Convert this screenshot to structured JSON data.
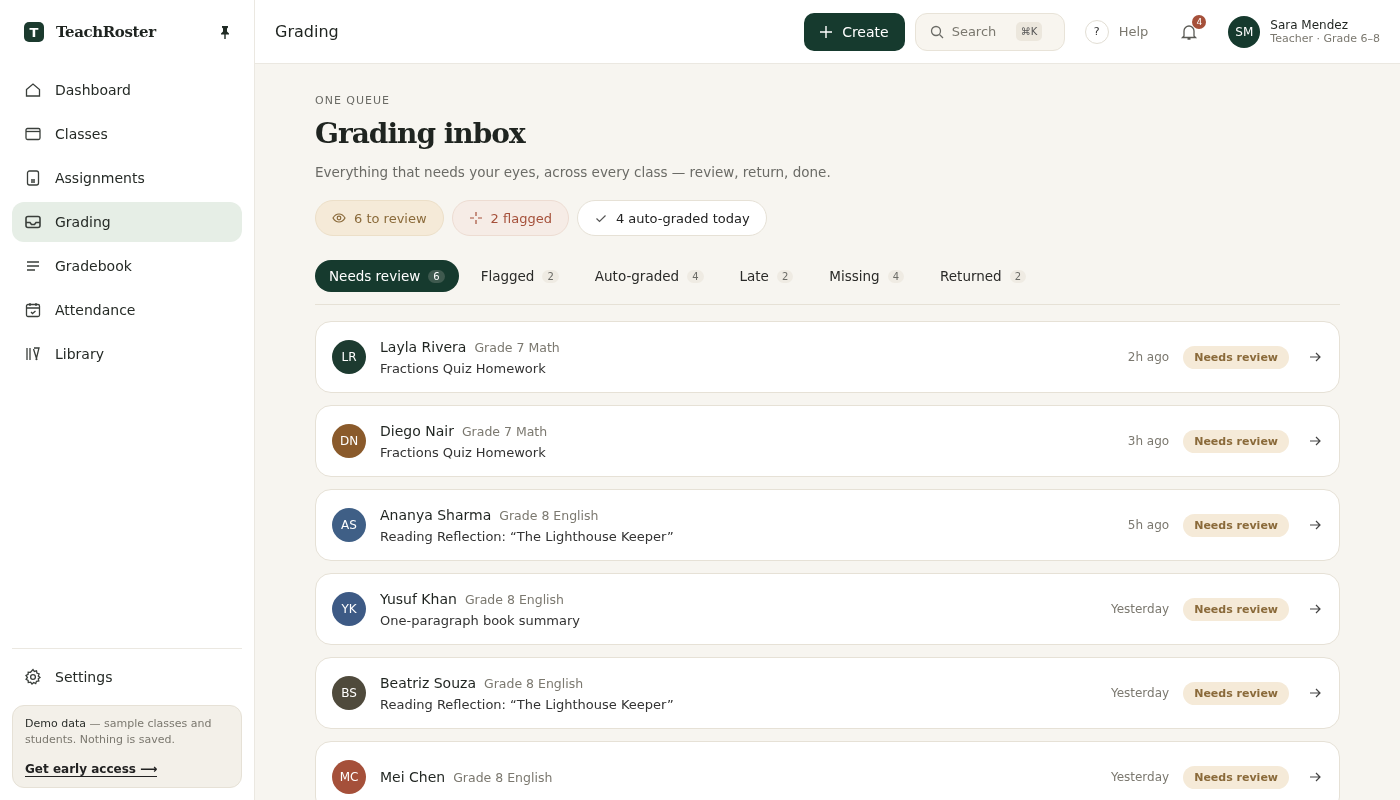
{
  "brand": {
    "name": "TeachRoster",
    "logo_letter": "T"
  },
  "nav": [
    {
      "label": "Dashboard",
      "kind": "home",
      "selected": false
    },
    {
      "label": "Classes",
      "kind": "card",
      "selected": false
    },
    {
      "label": "Assignments",
      "kind": "doc",
      "selected": false
    },
    {
      "label": "Grading",
      "kind": "inbox",
      "selected": true
    },
    {
      "label": "Gradebook",
      "kind": "lines",
      "selected": false
    },
    {
      "label": "Attendance",
      "kind": "calendar",
      "selected": false
    },
    {
      "label": "Library",
      "kind": "books",
      "selected": false
    }
  ],
  "settings": {
    "label": "Settings"
  },
  "demo_note": {
    "text": "**Demo data** — sample classes and students. Nothing is saved.",
    "link": "Get early access ⟶"
  },
  "header": {
    "title": "Grading",
    "create": "Create",
    "search_placeholder": "Search",
    "shortcut": "⌘K",
    "help_mark": "?",
    "help": "Help",
    "notifications": "4",
    "user": {
      "initials": "SM",
      "name": "Sara Mendez",
      "role": "Teacher · Grade 6–8"
    }
  },
  "page": {
    "eyebrow": "ONE QUEUE",
    "title": "Grading inbox",
    "subtitle": "Everything that needs your eyes, across every class — review, return, done."
  },
  "summary_chips": [
    {
      "kind": "review",
      "label": "6 to review"
    },
    {
      "kind": "flagged",
      "label": "2 flagged"
    },
    {
      "kind": "auto",
      "label": "4 auto-graded today"
    }
  ],
  "tabs": [
    {
      "label": "Needs review",
      "count": "6",
      "selected": true
    },
    {
      "label": "Flagged",
      "count": "2",
      "selected": false
    },
    {
      "label": "Auto-graded",
      "count": "4",
      "selected": false
    },
    {
      "label": "Late",
      "count": "2",
      "selected": false
    },
    {
      "label": "Missing",
      "count": "4",
      "selected": false
    },
    {
      "label": "Returned",
      "count": "2",
      "selected": false
    }
  ],
  "submissions": [
    {
      "initials": "LR",
      "color": "#1d3b30",
      "name": "Layla Rivera",
      "class": "Grade 7 Math",
      "assignment": "Fractions Quiz Homework",
      "time": "2h ago",
      "status": "Needs review"
    },
    {
      "initials": "DN",
      "color": "#8a5a2b",
      "name": "Diego Nair",
      "class": "Grade 7 Math",
      "assignment": "Fractions Quiz Homework",
      "time": "3h ago",
      "status": "Needs review"
    },
    {
      "initials": "AS",
      "color": "#3f5f86",
      "name": "Ananya Sharma",
      "class": "Grade 8 English",
      "assignment": "Reading Reflection: “The Lighthouse Keeper”",
      "time": "5h ago",
      "status": "Needs review"
    },
    {
      "initials": "YK",
      "color": "#3d5a85",
      "name": "Yusuf Khan",
      "class": "Grade 8 English",
      "assignment": "One-paragraph book summary",
      "time": "Yesterday",
      "status": "Needs review"
    },
    {
      "initials": "BS",
      "color": "#4f4a3c",
      "name": "Beatriz Souza",
      "class": "Grade 8 English",
      "assignment": "Reading Reflection: “The Lighthouse Keeper”",
      "time": "Yesterday",
      "status": "Needs review"
    },
    {
      "initials": "MC",
      "color": "#a5503a",
      "name": "Mei Chen",
      "class": "Grade 8 English",
      "time": "Yesterday",
      "status": "Needs review"
    }
  ]
}
